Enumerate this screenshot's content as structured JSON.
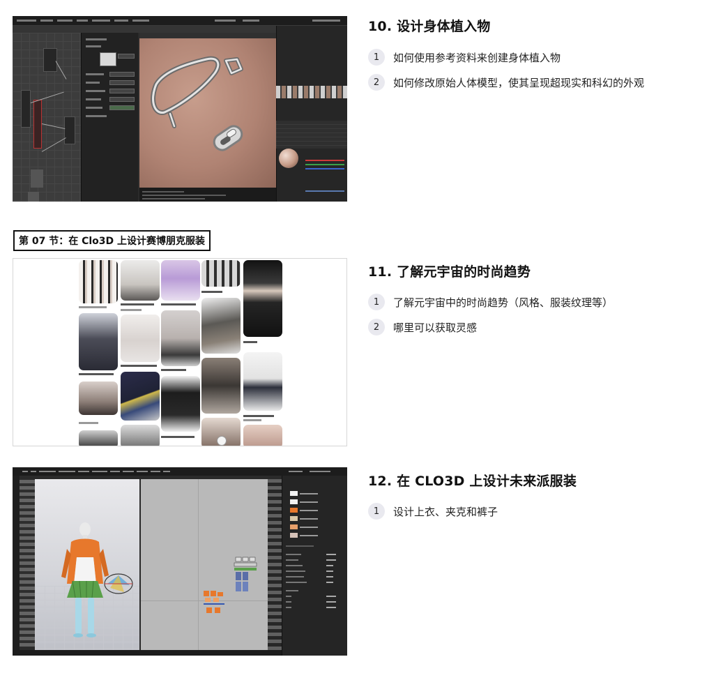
{
  "section_label": "第 07 节：在 Clo3D 上设计赛博朋克服装",
  "lessons": [
    {
      "title": "10. 设计身体植入物",
      "items": [
        {
          "num": "1",
          "text": "如何使用参考资料来创建身体植入物"
        },
        {
          "num": "2",
          "text": "如何修改原始人体模型，使其呈现超现实和科幻的外观"
        }
      ]
    },
    {
      "title": "11. 了解元宇宙的时尚趋势",
      "items": [
        {
          "num": "1",
          "text": "了解元宇宙中的时尚趋势（风格、服装纹理等）"
        },
        {
          "num": "2",
          "text": "哪里可以获取灵感"
        }
      ]
    },
    {
      "title": "12. 在 CLO3D 上设计未来派服装",
      "items": [
        {
          "num": "1",
          "text": "设计上衣、夹克和裤子"
        }
      ]
    }
  ],
  "colors": {
    "badge_bg": "#e9e9ef",
    "skin": "#b08373",
    "jacket": "#e7782c",
    "skirt": "#5aa04a"
  }
}
